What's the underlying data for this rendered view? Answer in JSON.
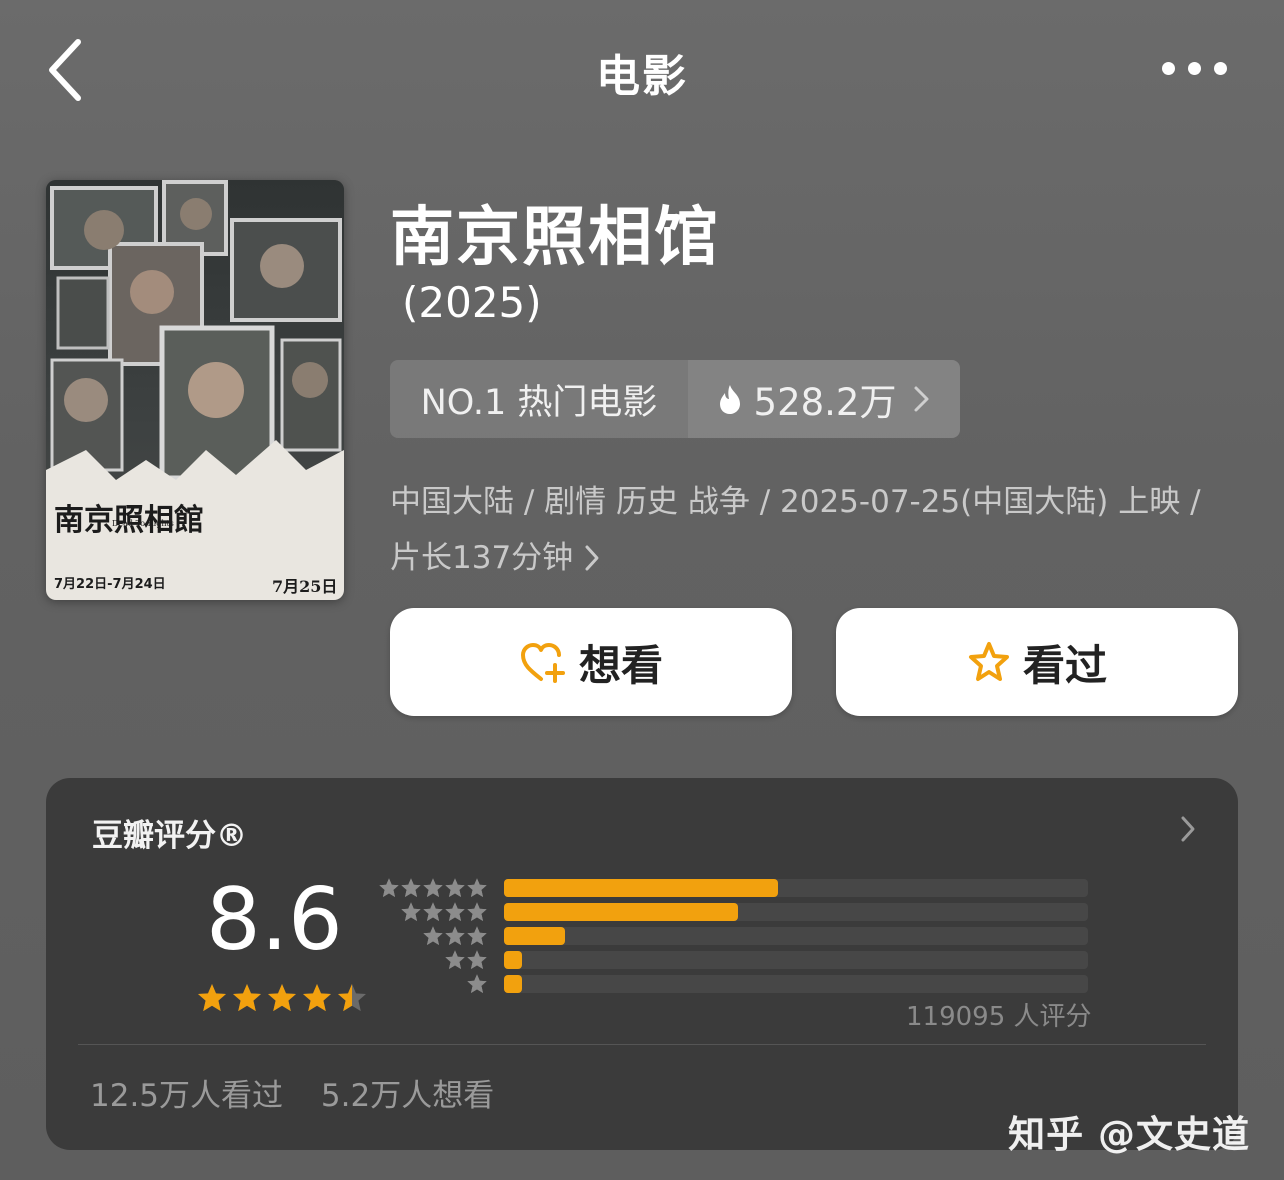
{
  "nav": {
    "title": "电影",
    "back_icon": "chevron-left-icon",
    "more_icon": "more-dots-icon"
  },
  "movie": {
    "title": "南京照相馆",
    "year": "(2025)",
    "poster": {
      "title_text": "南京照相館",
      "subtitle_text": "Dead To Rights",
      "dates_text": "7月22日-7月24日",
      "release_text": "7月25日"
    },
    "rank_label": "NO.1 热门电影",
    "heat_value": "528.2万",
    "meta_line1": "中国大陆 / 剧情 历史 战争 / 2025-07-25(中国大陆) 上映 /",
    "meta_line2": "片长137分钟"
  },
  "actions": {
    "want_label": "想看",
    "seen_label": "看过"
  },
  "rating": {
    "title": "豆瓣评分®",
    "score": "8.6",
    "stars": 4.5,
    "distribution": [
      {
        "stars": 5,
        "fraction": 0.47
      },
      {
        "stars": 4,
        "fraction": 0.4
      },
      {
        "stars": 3,
        "fraction": 0.105
      },
      {
        "stars": 2,
        "fraction": 0.03
      },
      {
        "stars": 1,
        "fraction": 0.03
      }
    ],
    "count_text": "119095 人评分",
    "seen_count": "12.5万人看过",
    "want_count": "5.2万人想看"
  },
  "watermark": "知乎 @文史道",
  "colors": {
    "accent": "#f2a10e",
    "card_bg": "#3b3b3b",
    "page_bg": "#636363"
  }
}
